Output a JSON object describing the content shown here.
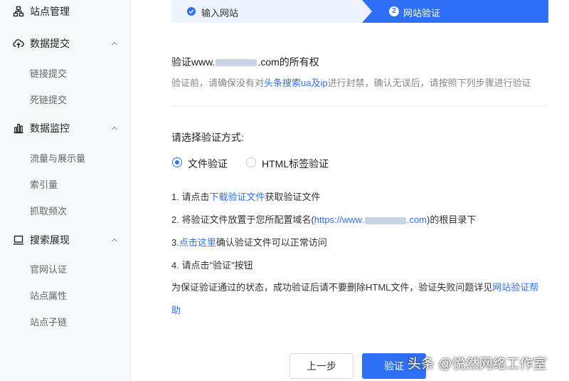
{
  "sidebar": {
    "site_mgmt": "站点管理",
    "data_submit": {
      "label": "数据提交",
      "items": [
        "链接提交",
        "死链提交"
      ]
    },
    "data_monitor": {
      "label": "数据监控",
      "items": [
        "流量与展示量",
        "索引量",
        "抓取频次"
      ]
    },
    "search_display": {
      "label": "搜索展现",
      "items": [
        "官网认证",
        "站点属性",
        "站点子链"
      ]
    }
  },
  "stepper": {
    "step1": "输入网站",
    "step2_num": "2",
    "step2": "网站验证"
  },
  "verify": {
    "title_prefix": "验证www.",
    "title_suffix": ".com的所有权",
    "desc_prefix": "验证前，请确保没有对",
    "desc_link": "头条搜索ua及ip",
    "desc_suffix": "进行封禁，确认无误后，请按照下列步骤进行验证"
  },
  "method": {
    "label": "请选择验证方式:",
    "options": [
      "文件验证",
      "HTML标签验证"
    ],
    "selected": "文件验证"
  },
  "steps": {
    "s1_prefix": "1. 请点击",
    "s1_link": "下载验证文件",
    "s1_suffix": "获取验证文件",
    "s2_prefix": "2. 将验证文件放置于您所配置域名(",
    "s2_link_prefix": "https://www.",
    "s2_link_suffix": ".com",
    "s2_suffix": ")的根目录下",
    "s3_prefix": "3.",
    "s3_link": "点击这里",
    "s3_suffix": "确认验证文件可以正常访问",
    "s4": "4. 请点击\"验证\"按钮",
    "note_prefix": "为保证验证通过的状态，成功验证后请不要删除HTML文件，验证失败问题详见",
    "note_link": "网站验证帮",
    "note_link2": "助"
  },
  "buttons": {
    "prev": "上一步",
    "verify": "验证"
  },
  "watermark": "头条 @悦然网络工作室",
  "colors": {
    "accent": "#2d6ff5",
    "sidebar_bg": "#f7f8fa"
  }
}
